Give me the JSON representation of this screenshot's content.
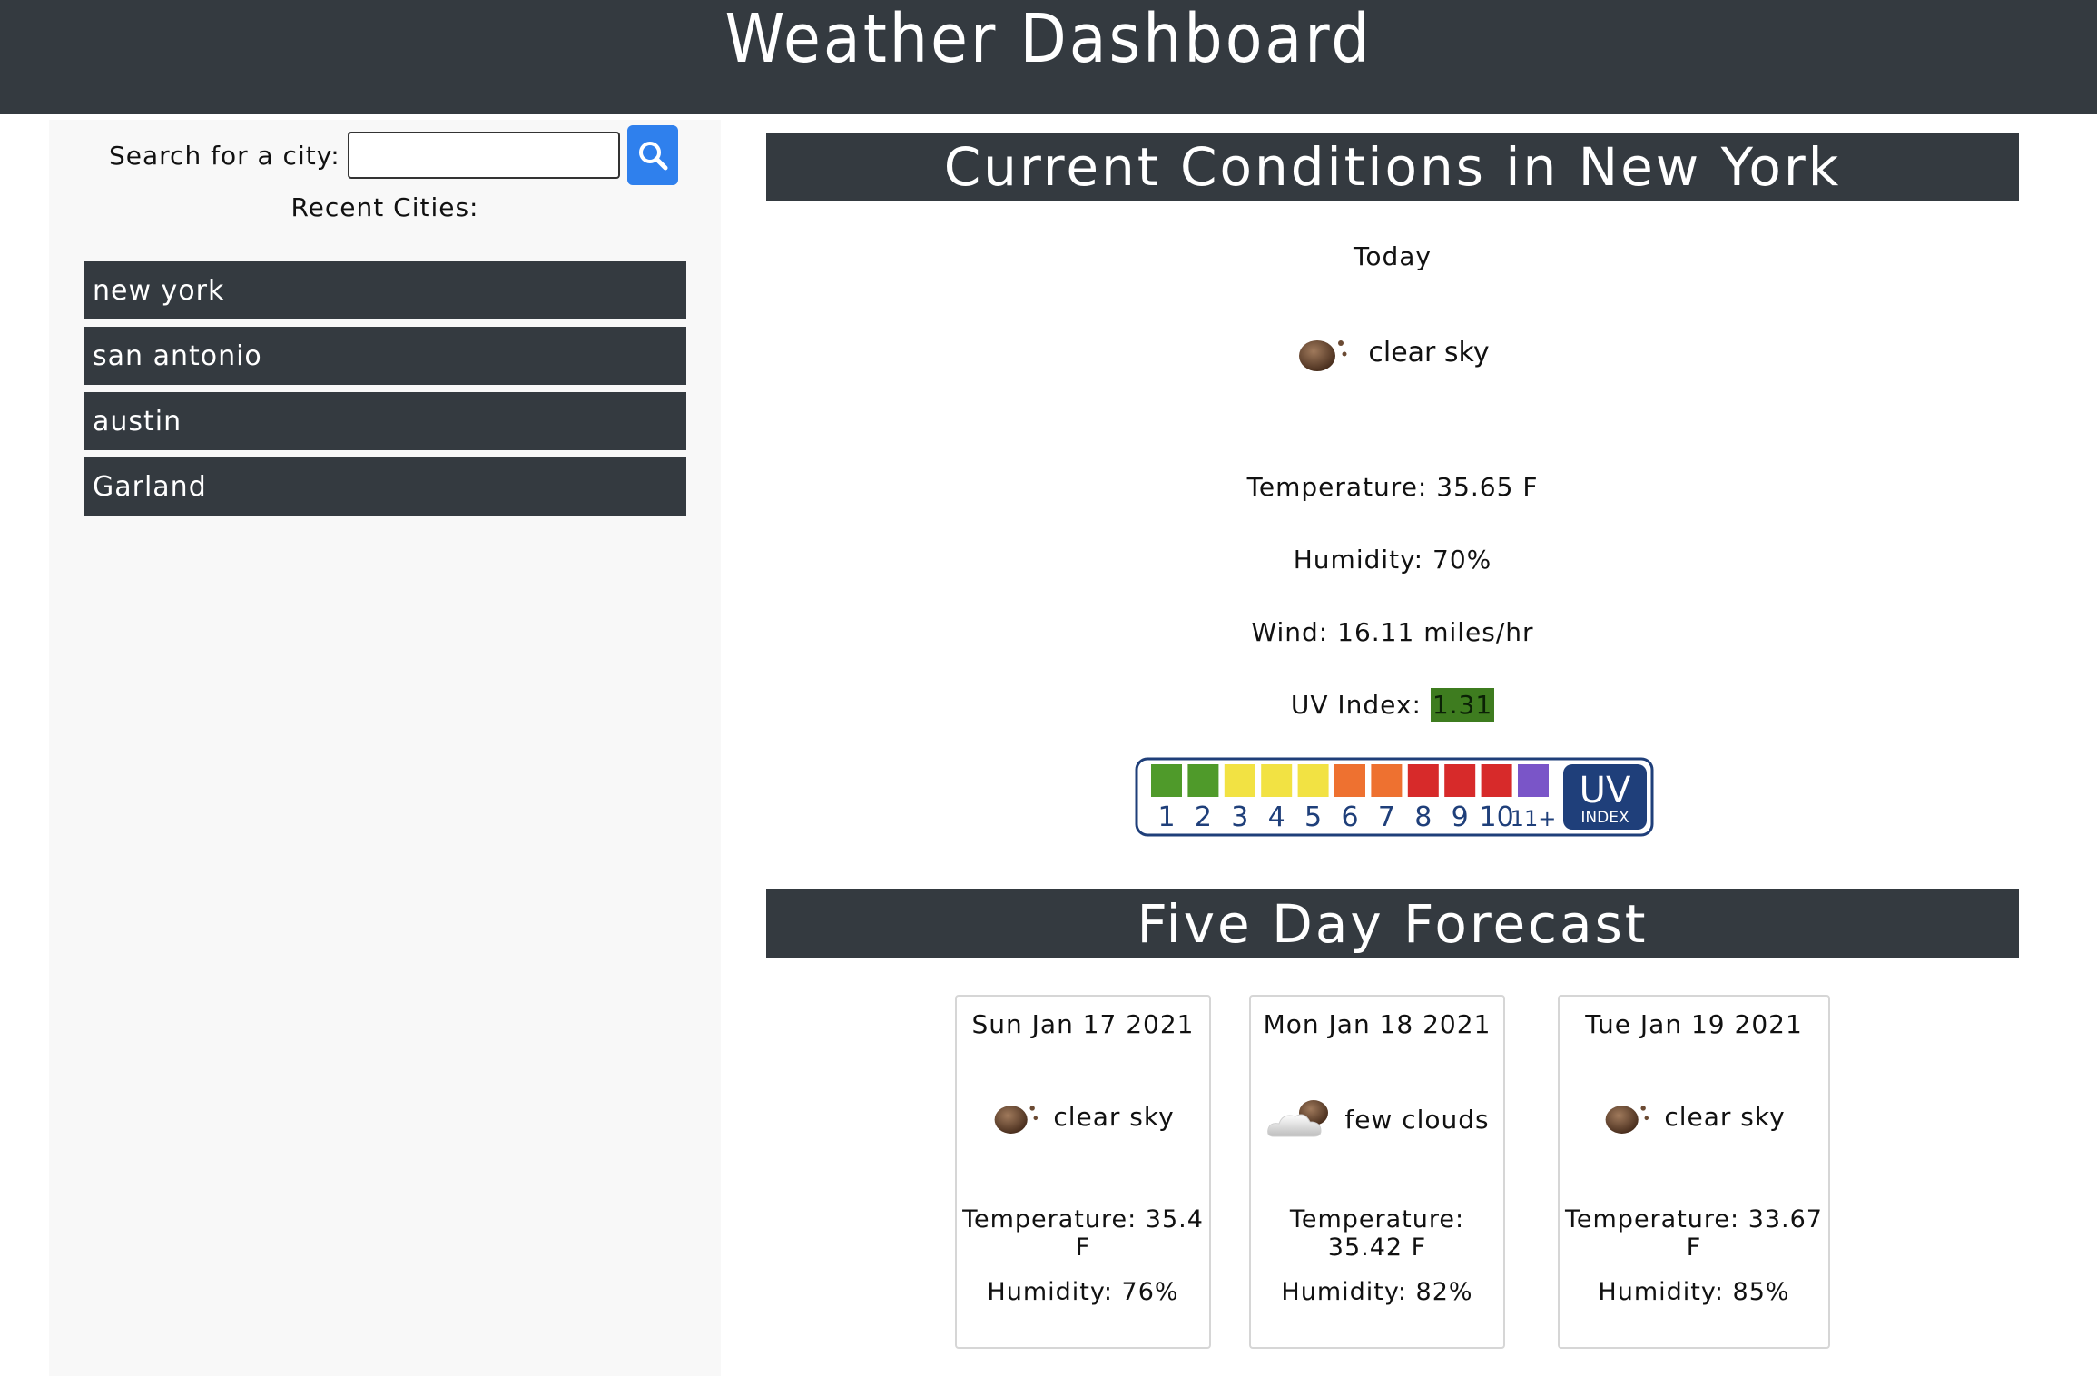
{
  "header": {
    "title": "Weather Dashboard"
  },
  "sidebar": {
    "search_label": "Search for a city:",
    "search_value": "",
    "search_icon": "search-icon",
    "recent_heading": "Recent Cities:",
    "cities": [
      "new york",
      "san antonio",
      "austin",
      "Garland"
    ]
  },
  "current": {
    "title": "Current Conditions in New York",
    "day": "Today",
    "icon": "clear-sky-icon",
    "condition": "clear sky",
    "temperature": "Temperature: 35.65 F",
    "humidity": "Humidity: 70%",
    "wind": "Wind: 16.11 miles/hr",
    "uv_label": "UV Index:",
    "uv_value": "1.31",
    "uv_color": "#3e7c1f"
  },
  "uv_scale": {
    "numbers": [
      "1",
      "2",
      "3",
      "4",
      "5",
      "6",
      "7",
      "8",
      "9",
      "10",
      "11+"
    ],
    "colors": [
      "#4f9a2a",
      "#4f9a2a",
      "#f2e243",
      "#f2e243",
      "#f2e243",
      "#ee7130",
      "#ee7130",
      "#d72a2a",
      "#d72a2a",
      "#d72a2a",
      "#7a55c8"
    ],
    "badge_big": "UV",
    "badge_small": "INDEX"
  },
  "forecast": {
    "title": "Five Day Forecast",
    "days": [
      {
        "date": "Sun Jan 17 2021",
        "icon": "clear-sky-icon",
        "condition": "clear sky",
        "temperature": "Temperature: 35.4 F",
        "humidity": "Humidity: 76%"
      },
      {
        "date": "Mon Jan 18 2021",
        "icon": "few-clouds-icon",
        "condition": "few clouds",
        "temperature": "Temperature: 35.42 F",
        "humidity": "Humidity: 82%"
      },
      {
        "date": "Tue Jan 19 2021",
        "icon": "clear-sky-icon",
        "condition": "clear sky",
        "temperature": "Temperature: 33.67 F",
        "humidity": "Humidity: 85%"
      }
    ]
  }
}
